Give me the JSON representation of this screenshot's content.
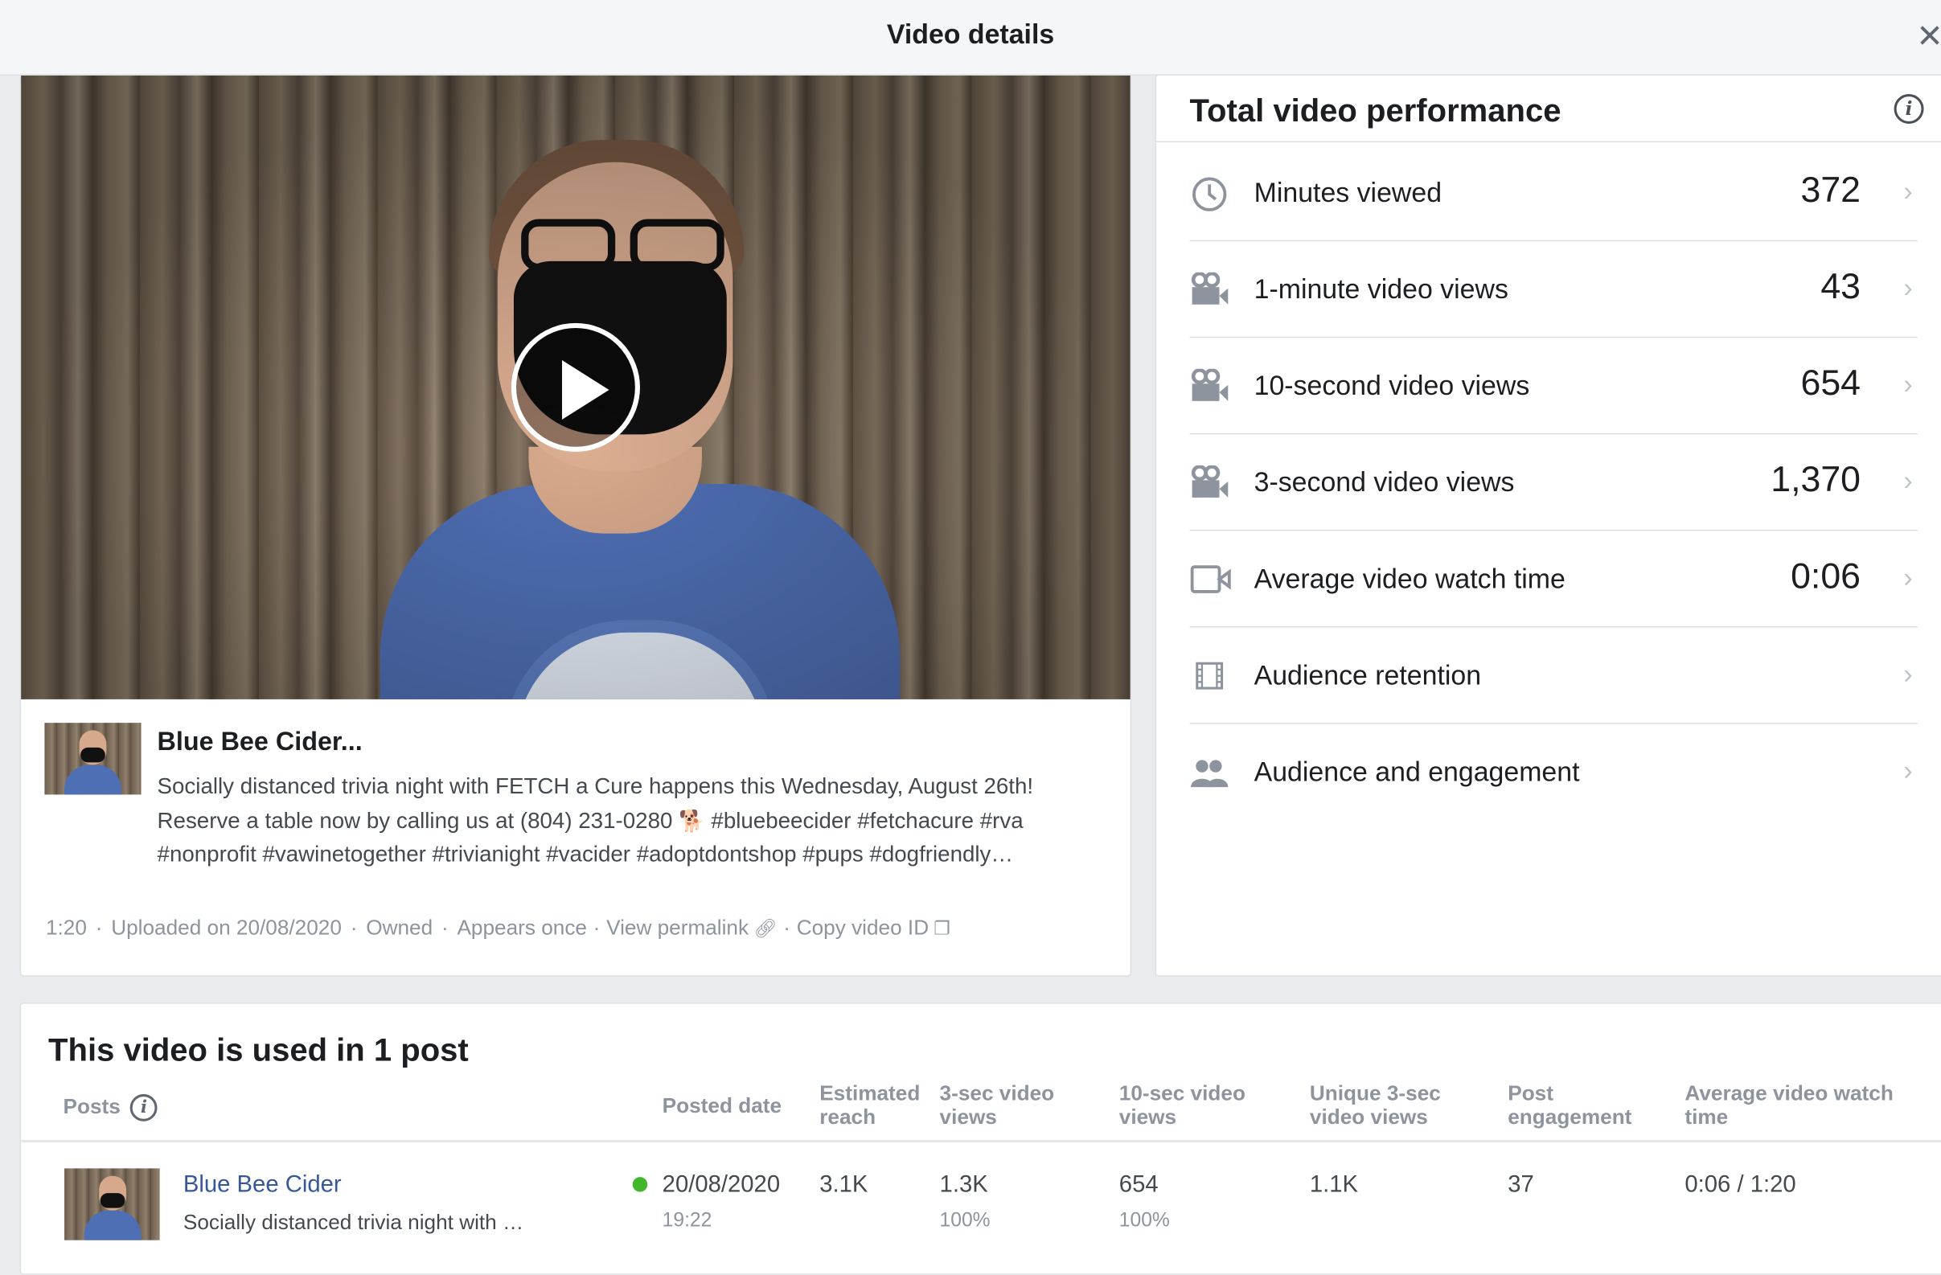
{
  "header": {
    "title": "Video details",
    "close_glyph": "✕"
  },
  "video": {
    "title": "Blue Bee Cider...",
    "description_line1": "Socially distanced trivia night with FETCH a Cure happens this Wednesday, August 26th!",
    "description_line2a": "Reserve a table now by calling us at (804) 231-0280 ",
    "description_emoji": "🐕",
    "description_line2b": " #bluebeecider #fetchacure #rva",
    "description_line3": "#nonprofit #vawinetogether #trivianight #vacider #adoptdontshop #pups #dogfriendly…",
    "duration": "1:20",
    "uploaded": "Uploaded on 20/08/2020",
    "owned": "Owned",
    "appears": "Appears once",
    "permalink_label": "View permalink",
    "copy_id_label": "Copy video ID",
    "play_icon": "play-icon"
  },
  "performance": {
    "title": "Total video performance",
    "info_glyph": "i",
    "metrics": [
      {
        "label": "Minutes viewed",
        "value": "372",
        "icon": "clock-icon"
      },
      {
        "label": "1-minute video views",
        "value": "43",
        "icon": "video-camera-icon"
      },
      {
        "label": "10-second video views",
        "value": "654",
        "icon": "video-camera-icon"
      },
      {
        "label": "3-second video views",
        "value": "1,370",
        "icon": "video-camera-icon"
      },
      {
        "label": "Average video watch time",
        "value": "0:06",
        "icon": "video-icon"
      },
      {
        "label": "Audience retention",
        "value": "",
        "icon": "film-strip-icon"
      },
      {
        "label": "Audience and engagement",
        "value": "",
        "icon": "people-icon"
      }
    ]
  },
  "posts": {
    "title": "This video is used in 1 post",
    "columns": {
      "posts": "Posts",
      "posted_date": "Posted date",
      "estimated_reach_1": "Estimated",
      "estimated_reach_2": "reach",
      "three_sec_1": "3-sec video",
      "three_sec_2": "views",
      "ten_sec_1": "10-sec video",
      "ten_sec_2": "views",
      "unique_1": "Unique 3-sec",
      "unique_2": "video views",
      "engagement_1": "Post",
      "engagement_2": "engagement",
      "avg_watch_1": "Average video watch",
      "avg_watch_2": "time"
    },
    "rows": [
      {
        "name": "Blue Bee Cider",
        "snippet": "Socially distanced trivia night with …",
        "date": "20/08/2020",
        "time": "19:22",
        "reach": "3.1K",
        "three_sec": "1.3K",
        "three_sec_pct": "100%",
        "ten_sec": "654",
        "ten_sec_pct": "100%",
        "unique": "1.1K",
        "engagement": "37",
        "avg_watch": "0:06 / 1:20",
        "status_color": "#42b72a"
      }
    ]
  }
}
